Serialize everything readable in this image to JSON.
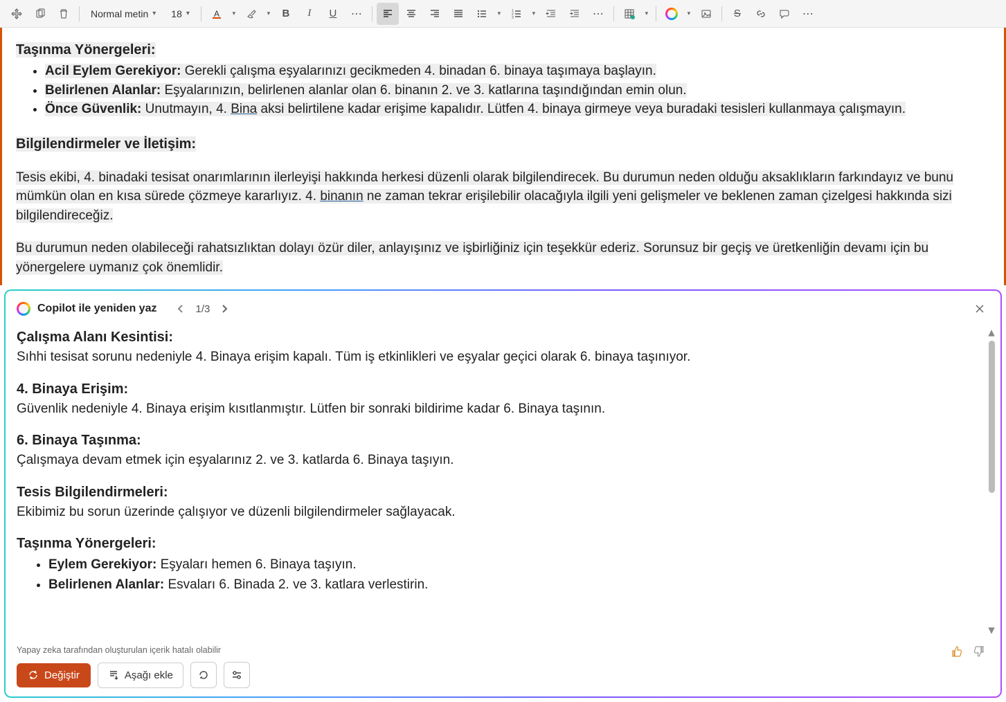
{
  "toolbar": {
    "style_select": "Normal metin",
    "font_size": "18"
  },
  "doc": {
    "h1": "Taşınma Yönergeleri:",
    "li1b": "Acil Eylem Gerekiyor:",
    "li1t": " Gerekli çalışma eşyalarınızı gecikmeden 4. binadan 6. binaya taşımaya başlayın.",
    "li2b": "Belirlenen Alanlar:",
    "li2t": " Eşyalarınızın, belirlenen alanlar olan 6. binanın 2. ve 3. katlarına taşındığından emin olun.",
    "li3b": "Önce Güvenlik:",
    "li3t1": " Unutmayın, 4. ",
    "li3u": "Bina",
    "li3t2": " aksi belirtilene kadar erişime kapalıdır. Lütfen 4. binaya girmeye veya buradaki tesisleri kullanmaya çalışmayın.",
    "h2": "Bilgilendirmeler ve İletişim:",
    "p1a": "Tesis ekibi, 4. binadaki tesisat onarımlarının ilerleyişi hakkında herkesi düzenli olarak bilgilendirecek. Bu durumun neden olduğu aksaklıkların farkındayız ve bunu mümkün olan en kısa sürede çözmeye kararlıyız. 4. ",
    "p1u": "binanın",
    "p1b": " ne zaman tekrar erişilebilir olacağıyla ilgili yeni gelişmeler ve beklenen zaman çizelgesi hakkında sizi bilgilendireceğiz.",
    "p2": "Bu durumun neden olabileceği rahatsızlıktan dolayı özür diler, anlayışınız ve işbirliğiniz için teşekkür ederiz. Sorunsuz bir geçiş ve üretkenliğin devamı için bu yönergelere uymanız çok önemlidir."
  },
  "copilot": {
    "title": "Copilot ile yeniden yaz",
    "page": "1/3",
    "s1h": "Çalışma Alanı Kesintisi:",
    "s1t": "Sıhhi tesisat sorunu nedeniyle 4. Binaya erişim kapalı. Tüm iş etkinlikleri ve eşyalar geçici olarak 6. binaya taşınıyor.",
    "s2h": "4. Binaya Erişim:",
    "s2t": "Güvenlik nedeniyle 4. Binaya erişim kısıtlanmıştır. Lütfen bir sonraki bildirime kadar 6. Binaya taşının.",
    "s3h": "6. Binaya Taşınma:",
    "s3t": "Çalışmaya devam etmek için eşyalarınız 2. ve 3. katlarda 6. Binaya taşıyın.",
    "s4h": "Tesis Bilgilendirmeleri:",
    "s4t": "Ekibimiz bu sorun üzerinde çalışıyor ve düzenli bilgilendirmeler sağlayacak.",
    "s5h": "Taşınma Yönergeleri:",
    "s5l1b": "Eylem Gerekiyor:",
    "s5l1t": " Eşyaları hemen 6. Binaya taşıyın.",
    "s5l2b": "Belirlenen Alanlar:",
    "s5l2t": " Esvaları 6. Binada 2. ve 3. katlara verlestirin.",
    "disclaimer": "Yapay zeka tarafından oluşturulan içerik hatalı olabilir",
    "replace": "Değiştir",
    "insert": "Aşağı ekle"
  }
}
